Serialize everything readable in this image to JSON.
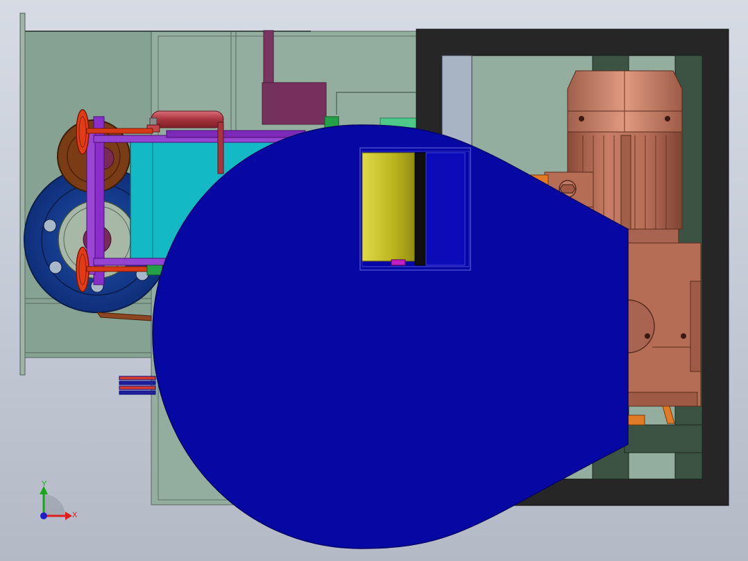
{
  "viewport": {
    "background_top": "#d6dbe4",
    "background_bottom": "#b3b9c5"
  },
  "colors": {
    "housing_green": "#8faa9a",
    "frame_dark": "#262626",
    "motor_copper": "#b56d56",
    "roller_blue": "#123a8f",
    "hopper_cyan": "#14b9c6",
    "frame_purple": "#8a2ec9",
    "handwheel_red": "#e23c17",
    "cover_blue": "#0707a3",
    "drum_yellow": "#c9c31f"
  },
  "triad": {
    "y_label": "Y",
    "x_label": "X",
    "y_color": "#1aa51a",
    "x_color": "#e01d1d",
    "z_color": "#1d1dcc"
  }
}
